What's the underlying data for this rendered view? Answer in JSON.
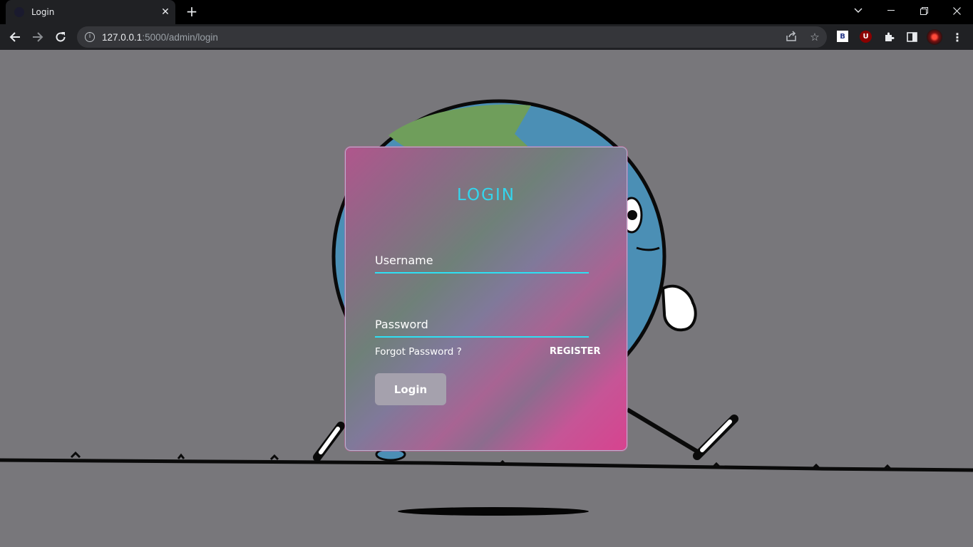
{
  "browser": {
    "tab_title": "Login",
    "tab_close": "✕",
    "new_tab": "+",
    "url_host": "127.0.0.1",
    "url_rest": ":5000/admin/login",
    "icons": [
      "back-icon",
      "forward-icon",
      "reload-icon",
      "info-icon",
      "share-icon",
      "star-icon",
      "extension-b-icon",
      "ublock-icon",
      "puzzle-icon",
      "sidepanel-icon",
      "profile-avatar",
      "menu-icon"
    ],
    "extension_b_label": "B",
    "extension_u_label": "U"
  },
  "login_card": {
    "title": "LOGIN",
    "username_label": "Username",
    "password_label": "Password",
    "forgot_password": "Forgot Password ?",
    "register": "REGISTER",
    "login_button": "Login"
  },
  "colors": {
    "accent": "#2ee0f3",
    "title": "#33d6ee",
    "card_pink": "#d7438f",
    "page_bg": "#78777b"
  }
}
